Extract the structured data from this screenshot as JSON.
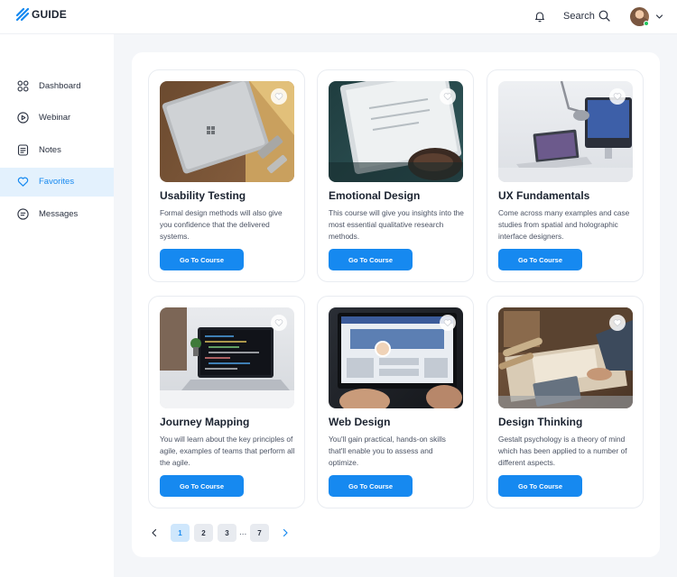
{
  "app": {
    "logo_text": "GUIDE",
    "brand_color": "#1689f0"
  },
  "header": {
    "search_label": "Search",
    "notification_icon": "bell-icon",
    "profile_icon": "avatar"
  },
  "sidebar": {
    "items": [
      {
        "label": "Dashboard",
        "icon": "grid-icon",
        "active": false
      },
      {
        "label": "Webinar",
        "icon": "play-icon",
        "active": false
      },
      {
        "label": "Notes",
        "icon": "notes-icon",
        "active": false
      },
      {
        "label": "Favorites",
        "icon": "heart-icon",
        "active": true
      },
      {
        "label": "Messages",
        "icon": "message-icon",
        "active": false
      }
    ]
  },
  "courses": [
    {
      "title": "Usability Testing",
      "description": "Formal design methods will also give you confidence that the delivered systems.",
      "button": "Go To Course"
    },
    {
      "title": "Emotional Design",
      "description": "This course will give you insights into the most essential qualitative research methods.",
      "button": "Go To Course"
    },
    {
      "title": "UX Fundamentals",
      "description": "Come across many examples and case studies from spatial and holographic interface designers.",
      "button": "Go To Course"
    },
    {
      "title": "Journey Mapping",
      "description": "You will learn about the key principles of agile, examples of teams that perform all the agile.",
      "button": "Go To Course"
    },
    {
      "title": "Web Design",
      "description": "You'll gain practical, hands-on skills that'll enable you to assess and optimize.",
      "button": "Go To Course"
    },
    {
      "title": "Design Thinking",
      "description": "Gestalt psychology is a theory of mind which has been applied to a number of different aspects.",
      "button": "Go To Course"
    }
  ],
  "pagination": {
    "pages": [
      "1",
      "2",
      "3",
      "7"
    ],
    "ellipsis": "...",
    "current": "1"
  }
}
